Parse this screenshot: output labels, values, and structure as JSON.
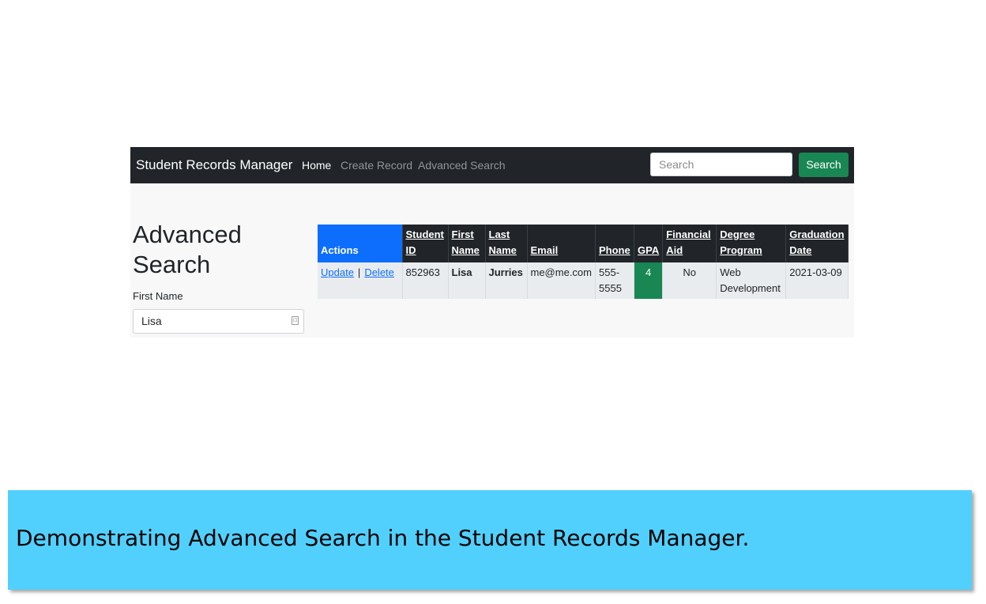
{
  "navbar": {
    "brand": "Student Records Manager",
    "links": [
      {
        "label": "Home",
        "active": true
      },
      {
        "label": "Create Record",
        "active": false
      },
      {
        "label": "Advanced Search",
        "active": false
      }
    ],
    "search_placeholder": "Search",
    "search_button": "Search"
  },
  "page": {
    "title": "Advanced Search",
    "field_label": "First Name",
    "field_value": "Lisa"
  },
  "table": {
    "headers": [
      {
        "line1": "",
        "line2": "Actions"
      },
      {
        "line1": "Student",
        "line2": "ID"
      },
      {
        "line1": "First",
        "line2": "Name"
      },
      {
        "line1": "Last",
        "line2": "Name"
      },
      {
        "line1": "",
        "line2": "Email"
      },
      {
        "line1": "",
        "line2": "Phone"
      },
      {
        "line1": "",
        "line2": "GPA"
      },
      {
        "line1": "Financial",
        "line2": "Aid"
      },
      {
        "line1": "Degree",
        "line2": "Program"
      },
      {
        "line1": "Graduation",
        "line2": "Date"
      }
    ],
    "rows": [
      {
        "update": "Update",
        "separator": "|",
        "delete": "Delete",
        "student_id": "852963",
        "first_name": "Lisa",
        "last_name": "Jurries",
        "email": "me@me.com",
        "phone_line1": "555-",
        "phone_line2": "5555",
        "gpa": "4",
        "financial_aid": "No",
        "program_line1": "Web",
        "program_line2": "Development",
        "graduation_date": "2021-03-09"
      }
    ]
  },
  "caption": "Demonstrating Advanced Search in the Student Records Manager.",
  "colors": {
    "navbar": "#212529",
    "primary": "#0d6efd",
    "success": "#198754",
    "caption_bg": "#51d0fd"
  }
}
